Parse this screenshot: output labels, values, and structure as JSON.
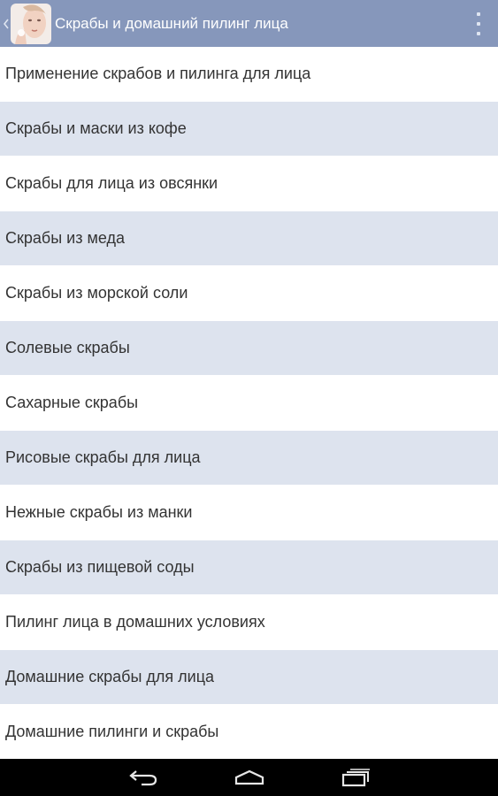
{
  "action_bar": {
    "title": "Скрабы и домашний пилинг лица",
    "icons": [
      "back-caret-icon",
      "app-logo-icon",
      "overflow-menu-icon"
    ]
  },
  "list": {
    "items": [
      "Применение скрабов и пилинга для лица",
      "Скрабы и маски из кофе",
      "Скрабы для лица из овсянки",
      "Скрабы из меда",
      "Скрабы из морской соли",
      "Солевые скрабы",
      "Сахарные скрабы",
      "Рисовые скрабы для лица",
      "Нежные скрабы из манки",
      "Скрабы из пищевой соды",
      "Пилинг лица в домашних условиях",
      "Домашние скрабы для лица",
      "Домашние пилинги и скрабы"
    ]
  },
  "navbar": {
    "icons": [
      "back-icon",
      "home-icon",
      "recents-icon"
    ]
  },
  "colors": {
    "action_bar": "#8697bb",
    "alt_row": "#dde3ee",
    "text": "#333333"
  }
}
